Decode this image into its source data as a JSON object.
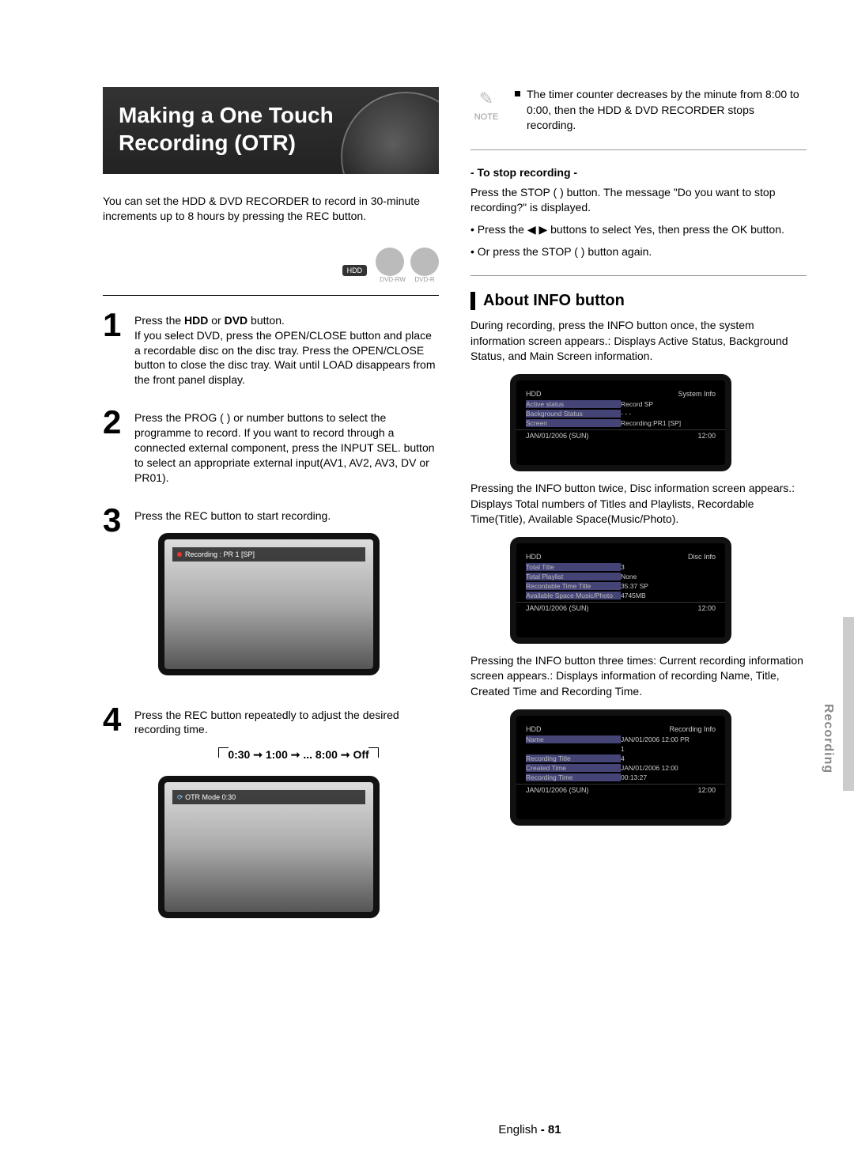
{
  "title_l1": "Making a One Touch",
  "title_l2": "Recording (OTR)",
  "intro": "You can set the HDD & DVD RECORDER to record in 30-minute increments up to 8 hours by pressing the REC button.",
  "badges": {
    "hdd": "HDD",
    "rw": "DVD-RW",
    "r": "DVD-R"
  },
  "steps": {
    "s1": {
      "num": "1",
      "text_a": "Press the ",
      "b1": "HDD",
      "mid": " or ",
      "b2": "DVD",
      "text_b": " button.",
      "line2": "If you select DVD, press the OPEN/CLOSE button and place a recordable disc on the disc tray. Press the OPEN/CLOSE button to close the disc tray. Wait until LOAD disappears from the front panel display."
    },
    "s2": {
      "num": "2",
      "text": "Press the PROG (    ) or number buttons to select the programme to record. If you want to record through a connected external component, press the INPUT SEL. button to select an appropriate external input(AV1, AV2, AV3, DV or PR01)."
    },
    "s3": {
      "num": "3",
      "text": "Press the REC button to start recording."
    },
    "s4": {
      "num": "4",
      "text": "Press the REC button repeatedly to adjust the desired recording time."
    }
  },
  "tv1_bar": "Recording : PR 1 [SP]",
  "cycle": "0:30 ➞ 1:00 ➞ ... 8:00 ➞ Off",
  "tv2_bar": "OTR Mode    0:30",
  "note_label": "NOTE",
  "note_text": "The timer counter decreases by the minute from 8:00 to 0:00, then the HDD & DVD RECORDER stops recording.",
  "stop_h": "- To stop recording -",
  "stop_p1": "Press the STOP (   ) button. The message \"Do you want to stop recording?\" is displayed.",
  "stop_b1": "• Press the ◀ ▶ buttons to select Yes, then press the OK button.",
  "stop_b2": "• Or press the STOP (   ) button again.",
  "info_h": "About INFO button",
  "info_p1": "During recording, press the INFO button once, the system information screen appears.: Displays Active Status, Background Status, and Main Screen information.",
  "info_p2": "Pressing the INFO button twice, Disc information screen appears.: Displays Total numbers of Titles and Playlists, Recordable Time(Title), Available Space(Music/Photo).",
  "info_p3": "Pressing the INFO button three times: Current recording information screen appears.: Displays information of recording Name, Title, Created Time and Recording Time.",
  "osd1": {
    "hl": "HDD",
    "hr": "System Info",
    "r1k": "Active status",
    "r1v": "Record SP",
    "r2k": "Background Status",
    "r2v": "- - -",
    "r3k": "Screen",
    "r3v": "Recording:PR1 [SP]",
    "fl": "JAN/01/2006 (SUN)",
    "fr": "12:00"
  },
  "osd2": {
    "hl": "HDD",
    "hr": "Disc Info",
    "r1k": "Total Title",
    "r1v": "3",
    "r2k": "Total Playlist",
    "r2v": "None",
    "r3k": "Recordable Time Title",
    "r3v": "35:37 SP",
    "r4k": "Available Space Music/Photo",
    "r4v": "4745MB",
    "fl": "JAN/01/2006 (SUN)",
    "fr": "12:00"
  },
  "osd3": {
    "hl": "HDD",
    "hr": "Recording Info",
    "r1k": "Name",
    "r1v": "JAN/01/2006 12:00 PR",
    "r2k": "",
    "r2v": "1",
    "r3k": "Recording Title",
    "r3v": "4",
    "r4k": "Created Time",
    "r4v": "JAN/01/2006 12:00",
    "r5k": "Recording Time",
    "r5v": "00:13:27",
    "fl": "JAN/01/2006 (SUN)",
    "fr": "12:00"
  },
  "side": "Recording",
  "footer_lang": "English",
  "footer_page": "- 81"
}
